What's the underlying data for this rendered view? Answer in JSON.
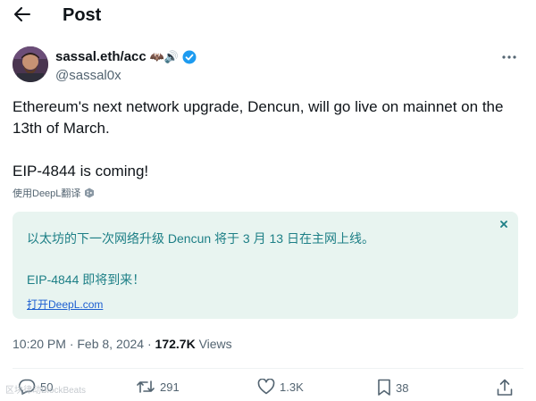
{
  "header": {
    "title": "Post"
  },
  "author": {
    "name": "sassal.eth/acc",
    "name_emoji": "🦇🔊",
    "handle": "@sassal0x",
    "verified_color": "#1d9bf0"
  },
  "tweet": {
    "line1": "Ethereum's next network upgrade, Dencun, will go live on mainnet on the 13th of March.",
    "line2": "EIP-4844 is coming!"
  },
  "deepl": {
    "label": "使用DeepL翻译"
  },
  "translation": {
    "line1": "以太坊的下一次网络升级 Dencun 将于 3 月 13 日在主网上线。",
    "line2": "EIP-4844 即将到来！",
    "open_link": "打开DeepL.com",
    "text_color": "#1d7f86",
    "bg_color": "#e8f4f0"
  },
  "meta": {
    "time": "10:20 PM · Feb 8, 2024 · ",
    "views_count": "172.7K",
    "views_label": " Views"
  },
  "actions": {
    "reply_count": "50",
    "retweet_count": "291",
    "like_count": "1.3K",
    "bookmark_count": "38"
  },
  "watermark": "区块律动BlockBeats"
}
